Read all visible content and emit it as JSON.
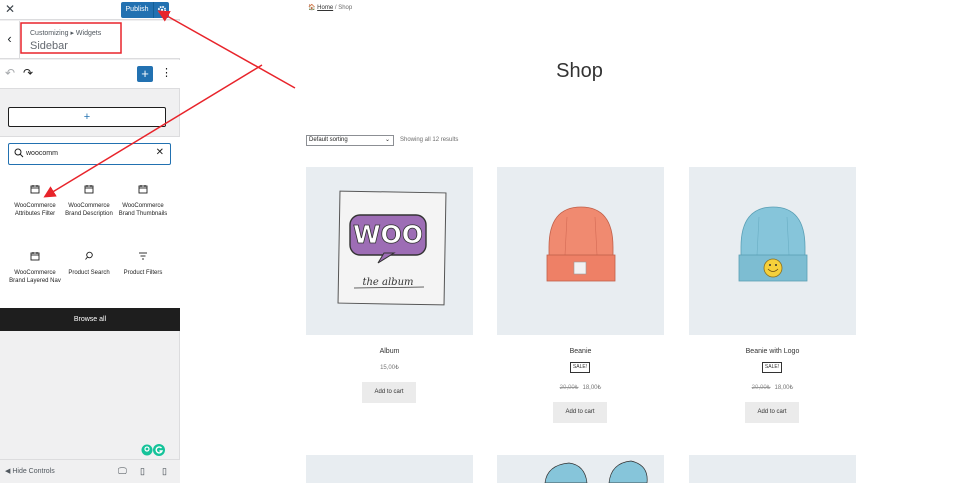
{
  "customizer": {
    "close_icon": "close-icon",
    "publish_label": "Publish",
    "breadcrumb": "Customizing ▸ Widgets",
    "section_title": "Sidebar",
    "search": {
      "value": "woocomm",
      "placeholder": "Search"
    },
    "blocks": [
      {
        "label": "WooCommerce Attributes Filter",
        "icon": "calendar-icon"
      },
      {
        "label": "WooCommerce Brand Description",
        "icon": "calendar-icon"
      },
      {
        "label": "WooCommerce Brand Thumbnails",
        "icon": "calendar-icon"
      },
      {
        "label": "WooCommerce Brand Layered Nav",
        "icon": "calendar-icon"
      },
      {
        "label": "Product Search",
        "icon": "search-icon"
      },
      {
        "label": "Product Filters",
        "icon": "filter-icon"
      }
    ],
    "browse_all": "Browse all",
    "hide_controls": "Hide Controls",
    "accent": "#2271b1"
  },
  "preview": {
    "breadcrumb_home": "Home",
    "breadcrumb_sep": "/",
    "breadcrumb_current": "Shop",
    "title": "Shop",
    "sorting": "Default sorting",
    "results": "Showing all 12 results",
    "products": [
      {
        "name": "Album",
        "price": "15,00₺",
        "sale": "",
        "old_price": "",
        "button": "Add to cart"
      },
      {
        "name": "Beanie",
        "price": "18,00₺",
        "sale": "SALE!",
        "old_price": "20,00₺",
        "button": "Add to cart"
      },
      {
        "name": "Beanie with Logo",
        "price": "18,00₺",
        "sale": "SALE!",
        "old_price": "20,00₺",
        "button": "Add to cart"
      }
    ]
  }
}
